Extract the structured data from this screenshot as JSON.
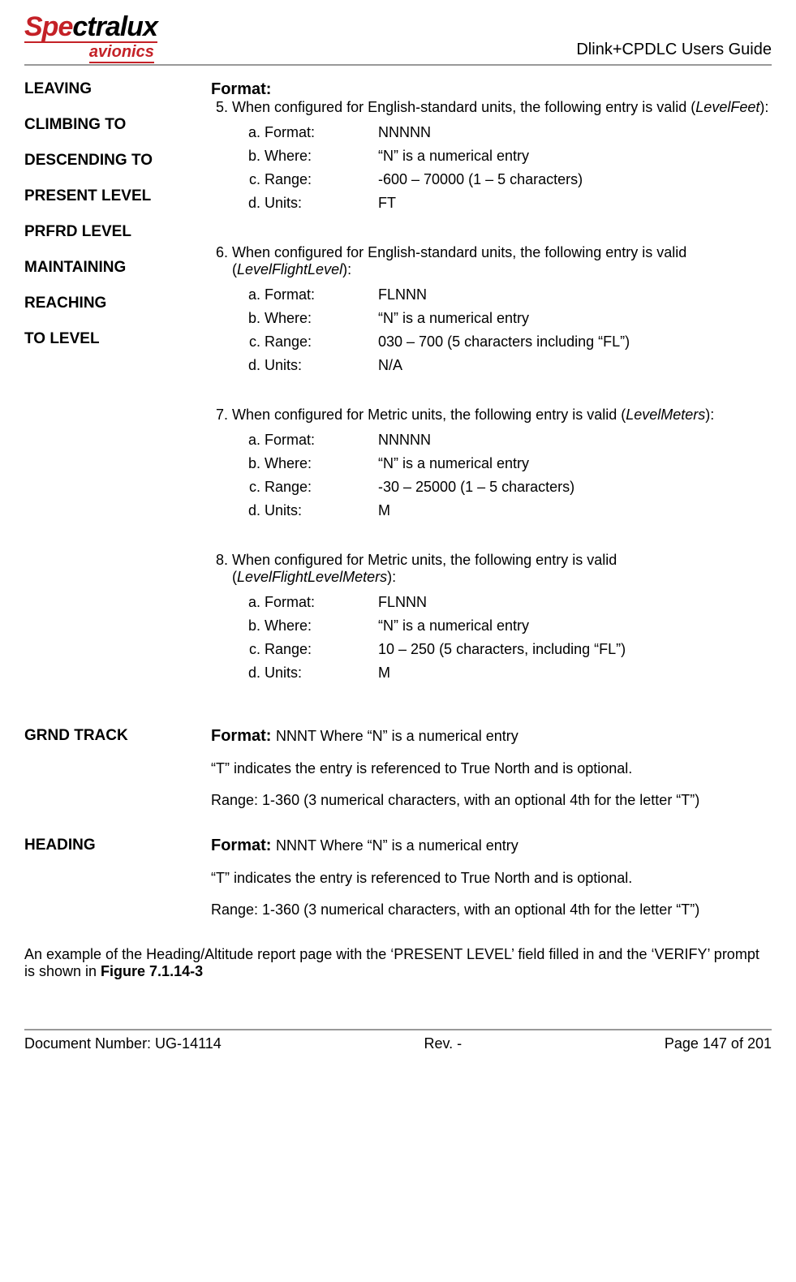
{
  "header": {
    "logo_red": "Spe",
    "logo_black": "ctralux",
    "logo_sub": "avionics",
    "doc_title": "Dlink+CPDLC Users Guide"
  },
  "left_terms": [
    "LEAVING",
    "CLIMBING TO",
    "DESCENDING TO",
    "PRESENT LEVEL",
    "PRFRD LEVEL",
    "MAINTAINING",
    "REACHING",
    "TO LEVEL"
  ],
  "format_label": "Format:",
  "item5": {
    "num": "5.",
    "lead1": "When configured for English-standard units, the following entry is valid (",
    "italic": "LevelFeet",
    "lead2": "):",
    "a_k": "Format:",
    "a_v": "NNNNN",
    "b_k": "Where:",
    "b_v": "“N” is a numerical entry",
    "c_k": "Range:",
    "c_v": "-600 – 70000 (1 – 5 characters)",
    "d_k": "Units:",
    "d_v": "FT"
  },
  "item6": {
    "num": "6.",
    "lead1": "When configured for English-standard units, the following entry is valid (",
    "italic": "LevelFlightLevel",
    "lead2": "):",
    "a_k": "Format:",
    "a_v": "FLNNN",
    "b_k": "Where:",
    "b_v": "“N” is a numerical entry",
    "c_k": "Range:",
    "c_v": "030 – 700 (5 characters      including “FL”)",
    "d_k": "Units:",
    "d_v": "N/A"
  },
  "item7": {
    "num": "7.",
    "lead1": "When configured for Metric units, the following entry is valid (",
    "italic": "LevelMeters",
    "lead2": "):",
    "a_k": "Format:",
    "a_v": "NNNNN",
    "b_k": "Where:",
    "b_v": "“N” is a numerical entry",
    "c_k": "Range:",
    "c_v": "-30 – 25000 (1 – 5 characters)",
    "d_k": "Units:",
    "d_v": "M"
  },
  "item8": {
    "num": "8.",
    "lead1": "When configured for Metric units, the following entry is valid (",
    "italic": "LevelFlightLevelMeters",
    "lead2": "):",
    "a_k": "Format:",
    "a_v": "FLNNN",
    "b_k": "Where:",
    "b_v": "“N” is a numerical entry",
    "c_k": "Range:",
    "c_v": "10 – 250 (5 characters, including “FL”)",
    "d_k": "Units:",
    "d_v": "M"
  },
  "grnd": {
    "label": "GRND TRACK",
    "line1a": "Format: ",
    "line1b": "NNNT Where “N” is a numerical entry",
    "line2": "“T” indicates the entry is referenced to True North and is optional.",
    "line3": "Range: 1-360 (3 numerical characters, with an optional 4th for the letter “T”)"
  },
  "heading": {
    "label": "HEADING",
    "line1a": "Format: ",
    "line1b": "NNNT Where “N” is a numerical entry",
    "line2": "“T” indicates the entry is referenced to True North and is optional.",
    "line3": "Range: 1-360 (3 numerical characters, with an optional 4th for the letter “T”)"
  },
  "bottom_note_a": "An example of the Heading/Altitude report page with the ‘PRESENT LEVEL’ field filled in and the ‘VERIFY’ prompt is shown in ",
  "bottom_note_b": "Figure 7.1.14-3",
  "footer": {
    "left": "Document Number:  UG-14114",
    "mid": "Rev. -",
    "right": "Page 147 of 201"
  }
}
